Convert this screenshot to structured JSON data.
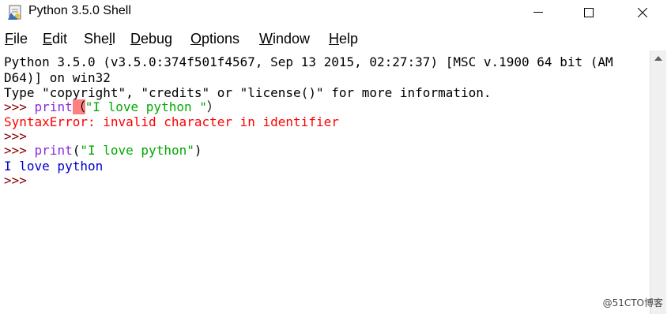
{
  "window": {
    "title": "Python 3.5.0 Shell"
  },
  "menu": {
    "items": [
      {
        "pre": "",
        "u": "F",
        "post": "ile"
      },
      {
        "pre": "",
        "u": "E",
        "post": "dit"
      },
      {
        "pre": "She",
        "u": "l",
        "post": "l"
      },
      {
        "pre": "",
        "u": "D",
        "post": "ebug"
      },
      {
        "pre": "",
        "u": "O",
        "post": "ptions"
      },
      {
        "pre": "",
        "u": "W",
        "post": "indow"
      },
      {
        "pre": "",
        "u": "H",
        "post": "elp"
      }
    ]
  },
  "shell": {
    "banner1": "Python 3.5.0 (v3.5.0:374f501f4567, Sep 13 2015, 02:27:37) [MSC v.1900 64 bit (AM",
    "banner2": "D64)] on win32",
    "banner3": "Type \"copyright\", \"credits\" or \"license()\" for more information.",
    "prompt": ">>>",
    "cmd1_kw": "print",
    "cmd1_err_char": "（",
    "cmd1_str": "\"I love python \"",
    "cmd1_close": "）",
    "error_msg": "SyntaxError: invalid character in identifier",
    "cmd2_kw": "print",
    "cmd2_open": "(",
    "cmd2_str": "\"I love python\"",
    "cmd2_close": ")",
    "output": "I love python"
  },
  "watermark": "@51CTO博客"
}
